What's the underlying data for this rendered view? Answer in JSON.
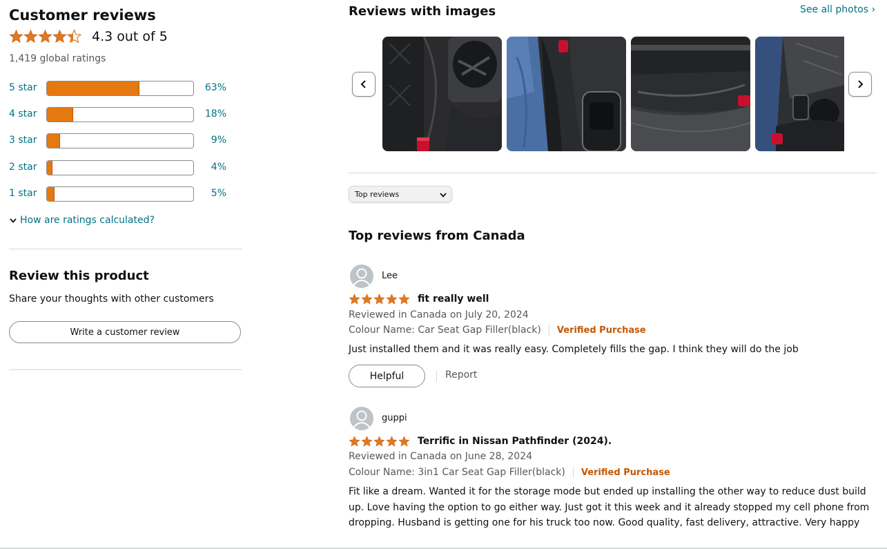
{
  "summary": {
    "title": "Customer reviews",
    "rating_value": 4.3,
    "rating_text": "4.3 out of 5",
    "global_ratings": "1,419 global ratings",
    "histogram": [
      {
        "label": "5 star",
        "percent": 63,
        "percent_text": "63%"
      },
      {
        "label": "4 star",
        "percent": 18,
        "percent_text": "18%"
      },
      {
        "label": "3 star",
        "percent": 9,
        "percent_text": "9%"
      },
      {
        "label": "2 star",
        "percent": 4,
        "percent_text": "4%"
      },
      {
        "label": "1 star",
        "percent": 5,
        "percent_text": "5%"
      }
    ],
    "how_calculated": "How are ratings calculated?"
  },
  "review_product": {
    "title": "Review this product",
    "subtitle": "Share your thoughts with other customers",
    "button_label": "Write a customer review"
  },
  "images_section": {
    "title": "Reviews with images",
    "see_all": "See all photos ›",
    "thumbnails": [
      "cup-holder-gap-filler-photo",
      "seat-gap-filler-leg-photo",
      "seat-side-gap-filler-photo",
      "console-gap-filler-photo"
    ]
  },
  "sort": {
    "selected": "Top reviews"
  },
  "reviews_section": {
    "title": "Top reviews from Canada",
    "reviews": [
      {
        "name": "Lee",
        "stars": 5,
        "title": "fit really well",
        "date": "Reviewed in Canada on July 20, 2024",
        "variant": "Colour Name: Car Seat Gap Filler(black)",
        "verified": "Verified Purchase",
        "body": "Just installed them and it was really easy. Completely fills the gap. I think they will do the job",
        "helpful": "Helpful",
        "report": "Report"
      },
      {
        "name": "guppi",
        "stars": 5,
        "title": "Terrific in Nissan Pathfinder (2024).",
        "date": "Reviewed in Canada on June 28, 2024",
        "variant": "Colour Name: 3in1 Car Seat Gap Filler(black)",
        "verified": "Verified Purchase",
        "body": "Fit like a dream. Wanted it for the storage mode but ended up installing the other way to reduce dust build up. Love having the option to go either way. Just got it this week and it already stopped my cell phone from dropping. Husband is getting one for his truck too now. Good quality, fast delivery, attractive. Very happy"
      }
    ]
  },
  "colors": {
    "star": "#de7921",
    "bar_fill": "#e47911",
    "link": "#007185",
    "verified": "#c45500"
  }
}
